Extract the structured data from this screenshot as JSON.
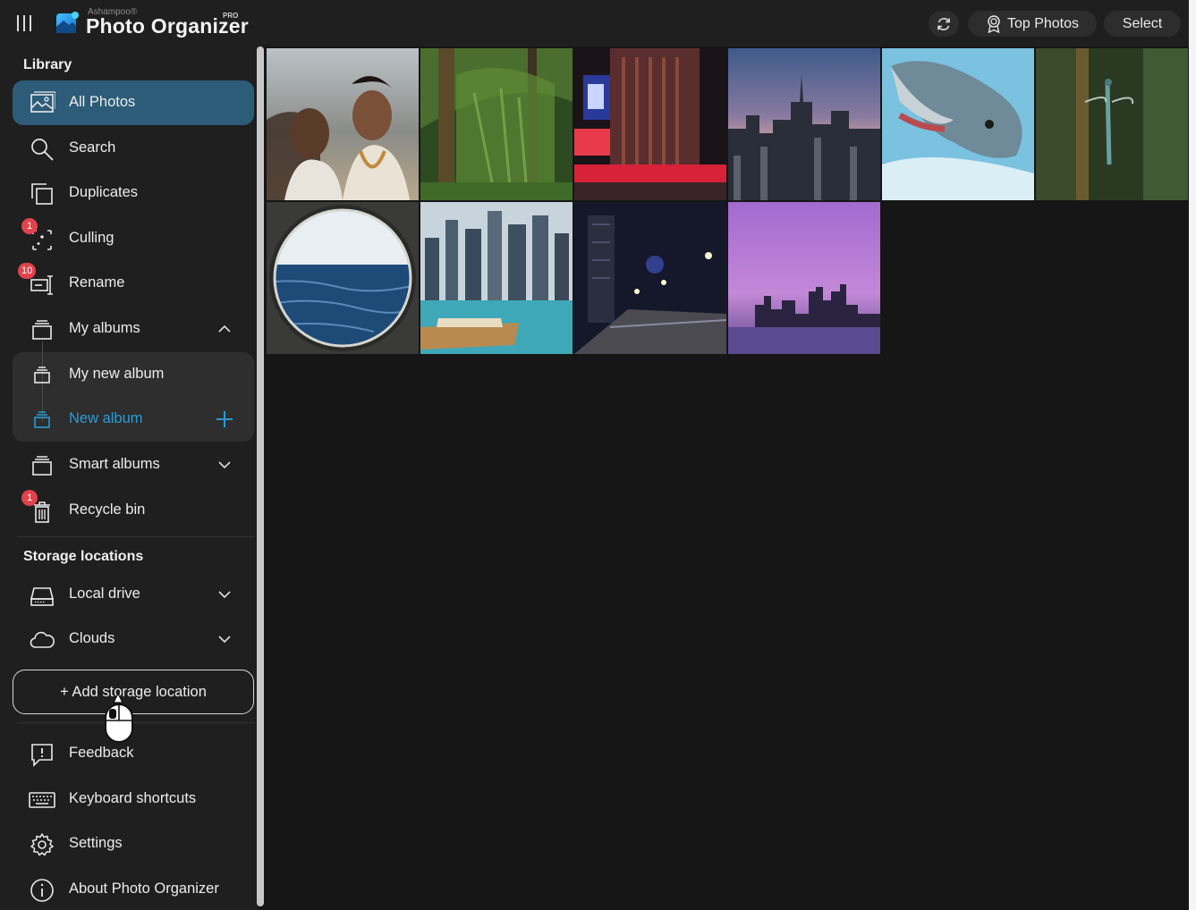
{
  "header": {
    "brand_small": "Ashampoo®",
    "brand_main": "Photo Organizer",
    "brand_tag": "PRO",
    "top_photos_label": "Top Photos",
    "select_label": "Select"
  },
  "sidebar": {
    "library_title": "Library",
    "items": [
      {
        "label": "All Photos",
        "icon": "image-icon"
      },
      {
        "label": "Search",
        "icon": "search-icon"
      },
      {
        "label": "Duplicates",
        "icon": "duplicates-icon"
      },
      {
        "label": "Culling",
        "icon": "culling-icon",
        "badge": "1"
      },
      {
        "label": "Rename",
        "icon": "rename-icon",
        "badge": "10"
      },
      {
        "label": "My albums",
        "icon": "album-icon"
      },
      {
        "label": "My new album",
        "icon": "album-icon"
      },
      {
        "label": "New album",
        "icon": "album-icon"
      },
      {
        "label": "Smart albums",
        "icon": "smart-album-icon"
      },
      {
        "label": "Recycle bin",
        "icon": "trash-icon",
        "badge": "1"
      }
    ],
    "storage_title": "Storage locations",
    "storage_items": [
      {
        "label": "Local drive",
        "icon": "drive-icon"
      },
      {
        "label": "Clouds",
        "icon": "cloud-icon"
      }
    ],
    "add_storage_label": "+ Add storage location",
    "footer_items": [
      {
        "label": "Feedback",
        "icon": "feedback-icon"
      },
      {
        "label": "Keyboard shortcuts",
        "icon": "keyboard-icon"
      },
      {
        "label": "Settings",
        "icon": "gear-icon"
      },
      {
        "label": "About Photo Organizer",
        "icon": "info-icon"
      }
    ]
  },
  "colors": {
    "accent": "#2c5c78",
    "accent_text": "#2a9bd6",
    "badge": "#e0434c",
    "background": "#161616",
    "sidebar": "#1f1f1f"
  },
  "photos": [
    {
      "subject": "couple on beach"
    },
    {
      "subject": "forest trees"
    },
    {
      "subject": "city street at night"
    },
    {
      "subject": "city skyline at dusk"
    },
    {
      "subject": "dolphin"
    },
    {
      "subject": "dragonfly"
    },
    {
      "subject": "sea through porthole"
    },
    {
      "subject": "harbor with skyscrapers"
    },
    {
      "subject": "promenade at night"
    },
    {
      "subject": "purple skyline"
    }
  ]
}
